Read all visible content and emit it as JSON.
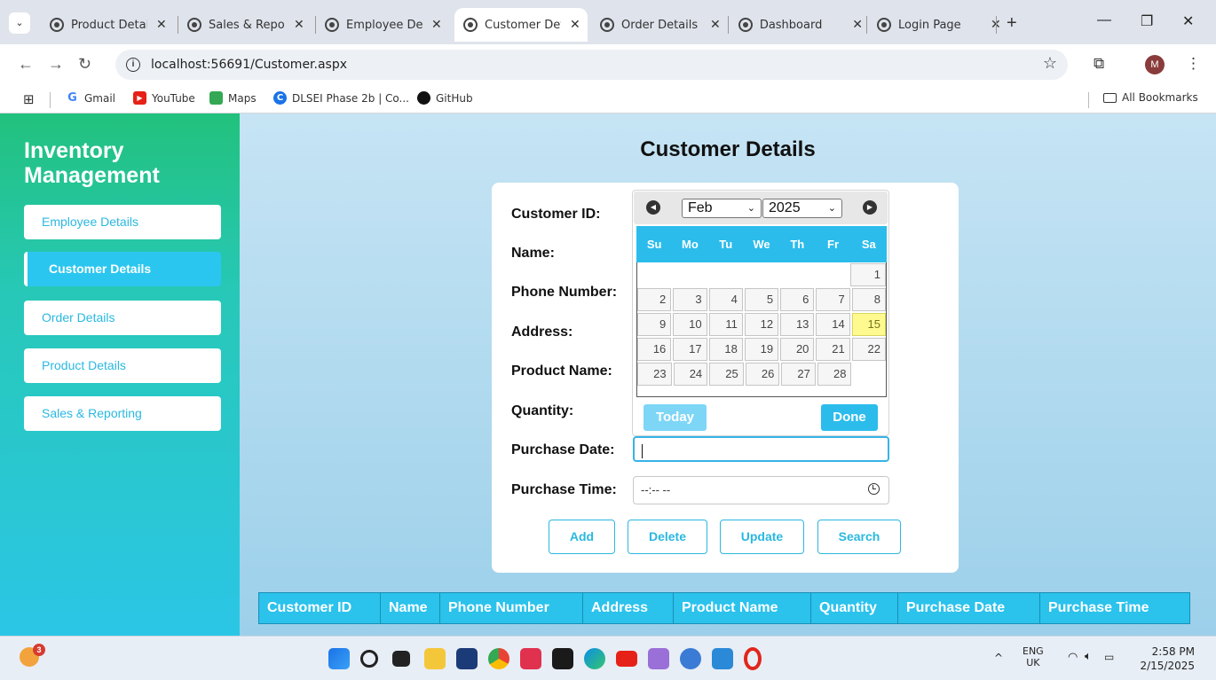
{
  "browser": {
    "tabs": [
      {
        "title": "Product Detail",
        "active": false
      },
      {
        "title": "Sales & Repor",
        "active": false
      },
      {
        "title": "Employee Det",
        "active": false
      },
      {
        "title": "Customer Det",
        "active": true
      },
      {
        "title": "Order Details",
        "active": false
      },
      {
        "title": "Dashboard",
        "active": false
      },
      {
        "title": "Login Page",
        "active": false
      }
    ],
    "tab_close": "✕",
    "new_tab": "+",
    "url": "localhost:56691/Customer.aspx",
    "profile_initial": "M",
    "bookmarks": [
      "Gmail",
      "YouTube",
      "Maps",
      "DLSEI Phase 2b | Co...",
      "GitHub"
    ],
    "all_bookmarks": "All Bookmarks"
  },
  "sidebar": {
    "brand": "Inventory Management",
    "items": [
      {
        "label": "Employee Details",
        "active": false
      },
      {
        "label": "Customer Details",
        "active": true
      },
      {
        "label": "Order Details",
        "active": false
      },
      {
        "label": "Product Details",
        "active": false
      },
      {
        "label": "Sales & Reporting",
        "active": false
      }
    ]
  },
  "main": {
    "title": "Customer Details",
    "form": {
      "labels": [
        "Customer ID:",
        "Name:",
        "Phone Number:",
        "Address:",
        "Product Name:",
        "Quantity:",
        "Purchase Date:",
        "Purchase Time:"
      ],
      "purchase_date_value": "",
      "purchase_time_value": "--:-- --",
      "buttons": [
        "Add",
        "Delete",
        "Update",
        "Search"
      ]
    },
    "datepicker": {
      "month": "Feb",
      "year": "2025",
      "weekdays": [
        "Su",
        "Mo",
        "Tu",
        "We",
        "Th",
        "Fr",
        "Sa"
      ],
      "weeks": [
        [
          "",
          "",
          "",
          "",
          "",
          "",
          "1"
        ],
        [
          "2",
          "3",
          "4",
          "5",
          "6",
          "7",
          "8"
        ],
        [
          "9",
          "10",
          "11",
          "12",
          "13",
          "14",
          "15"
        ],
        [
          "16",
          "17",
          "18",
          "19",
          "20",
          "21",
          "22"
        ],
        [
          "23",
          "24",
          "25",
          "26",
          "27",
          "28",
          ""
        ]
      ],
      "highlighted_day": "15",
      "today_label": "Today",
      "done_label": "Done"
    },
    "grid_headers": [
      "Customer ID",
      "Name",
      "Phone Number",
      "Address",
      "Product Name",
      "Quantity",
      "Purchase Date",
      "Purchase Time"
    ]
  },
  "taskbar": {
    "notification_count": "3",
    "lang_top": "ENG",
    "lang_bottom": "UK",
    "time": "2:58 PM",
    "date": "2/15/2025"
  },
  "colors": {
    "accent": "#2bc2ec",
    "sidebar_top": "#22c17d",
    "today_highlight": "#fffa90"
  }
}
